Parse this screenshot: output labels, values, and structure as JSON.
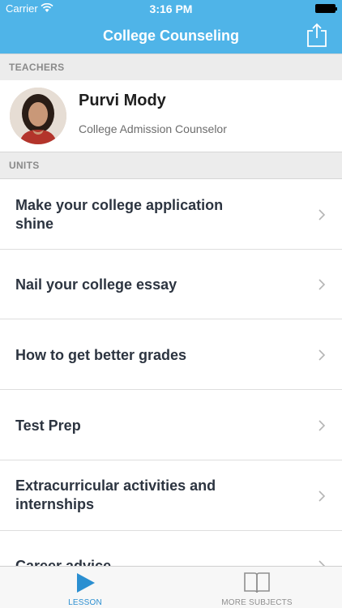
{
  "status_bar": {
    "carrier": "Carrier",
    "time": "3:16 PM"
  },
  "nav": {
    "title": "College Counseling",
    "share_icon": "share-icon"
  },
  "sections": {
    "teachers": "TEACHERS",
    "units": "UNITS"
  },
  "teacher": {
    "name": "Purvi Mody",
    "role": "College Admission Counselor"
  },
  "units": [
    {
      "line1": "Make your college application",
      "line2": "shine"
    },
    {
      "line1": "Nail your college essay",
      "line2": ""
    },
    {
      "line1": "How to get better grades",
      "line2": ""
    },
    {
      "line1": "Test Prep",
      "line2": ""
    },
    {
      "line1": "Extracurricular activities and",
      "line2": "internships"
    },
    {
      "line1": "Career advice",
      "line2": ""
    }
  ],
  "tabs": {
    "lesson": {
      "label": "LESSON",
      "icon": "play-icon",
      "color": "#2b8fd1"
    },
    "more": {
      "label": "MORE SUBJECTS",
      "icon": "book-icon",
      "color": "#8f8f8f"
    }
  },
  "colors": {
    "header": "#4fb4e8",
    "section_bg": "#ececec",
    "text_dark": "#2c3440"
  }
}
